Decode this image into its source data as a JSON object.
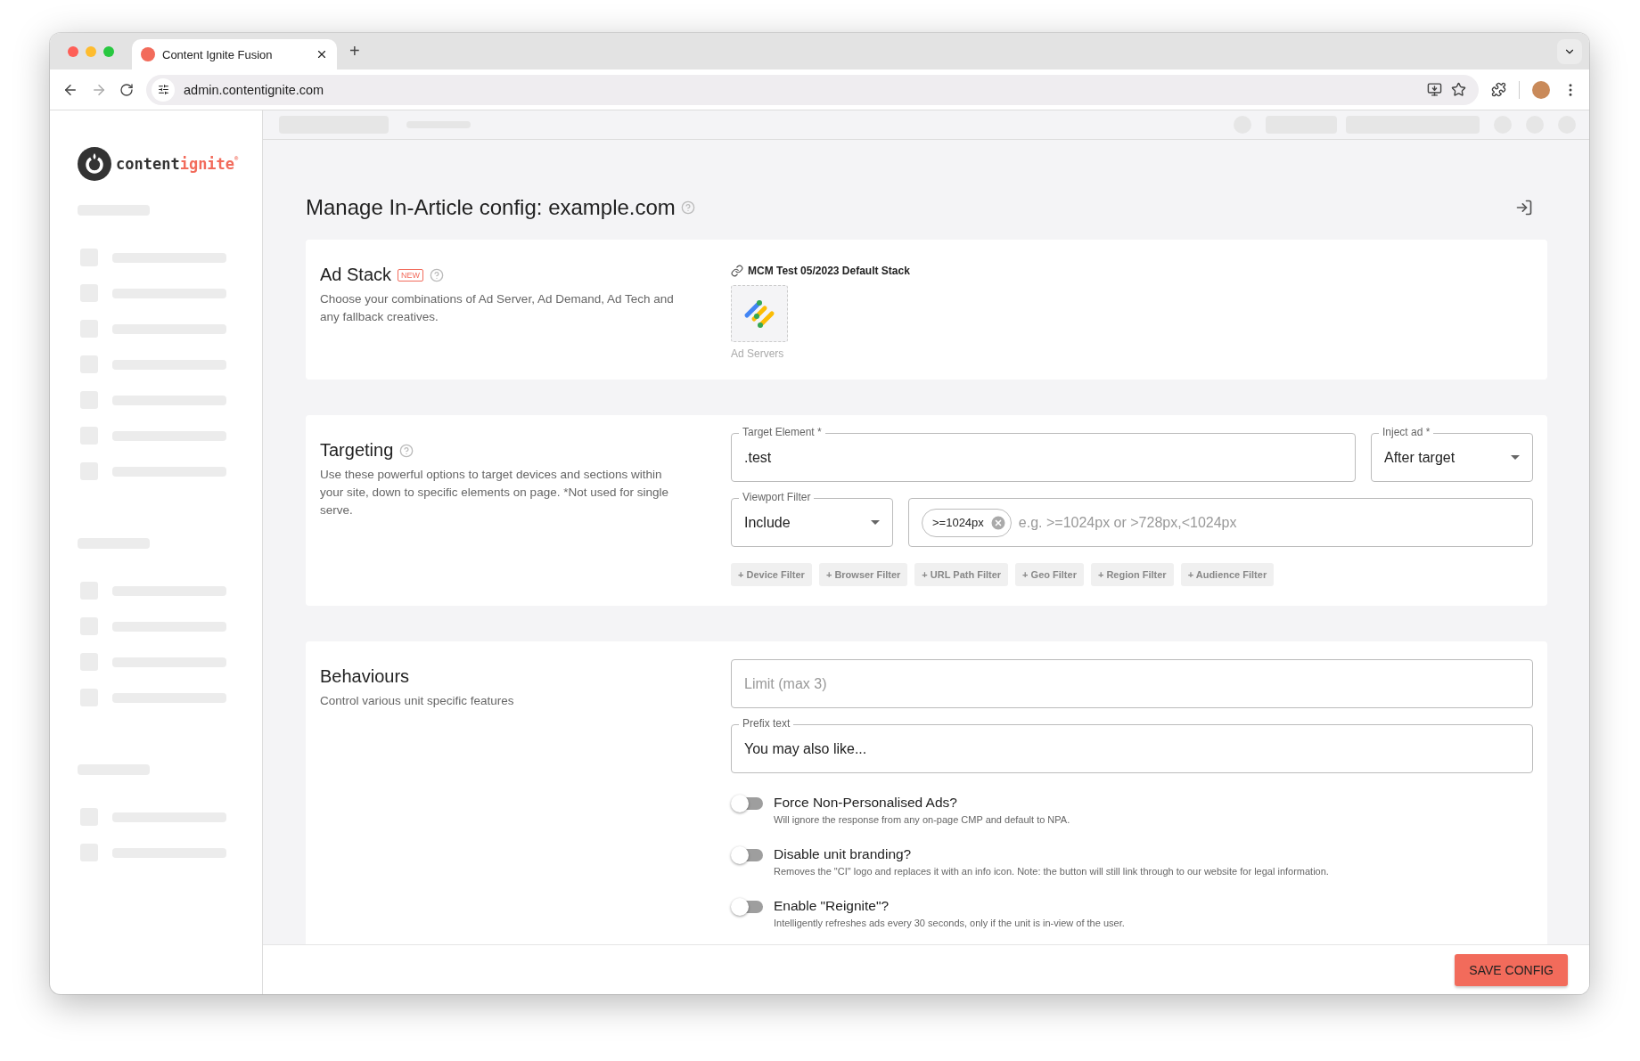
{
  "browser": {
    "tab_title": "Content Ignite Fusion",
    "new_tab": "+",
    "url": "admin.contentignite.com"
  },
  "sidebar": {
    "logo": [
      "content",
      "ignite",
      "®"
    ]
  },
  "page": {
    "title": "Manage In-Article config: example.com"
  },
  "sections": [
    {
      "kind": "ad_stack",
      "title": "Ad Stack",
      "badge": "NEW",
      "help": true,
      "description": "Choose your combinations of Ad Server, Ad Demand, Ad Tech and any fallback creatives.",
      "stack_name": "MCM Test 05/2023 Default Stack",
      "tiles": [
        {
          "label": "Ad Servers"
        }
      ]
    },
    {
      "kind": "targeting",
      "title": "Targeting",
      "help": true,
      "description": "Use these powerful options to target devices and sections within your site, down to specific elements on page. *Not used for single serve.",
      "target_element": {
        "label": "Target Element *",
        "value": ".test"
      },
      "inject_ad": {
        "label": "Inject ad *",
        "value": "After target"
      },
      "viewport_filter": {
        "label": "Viewport Filter",
        "value": "Include"
      },
      "viewport_values": {
        "chips": [
          ">=1024px"
        ],
        "placeholder": "e.g. >=1024px or >728px,<1024px"
      },
      "filters": [
        "+ Device Filter",
        "+ Browser Filter",
        "+ URL Path Filter",
        "+ Geo Filter",
        "+ Region Filter",
        "+ Audience Filter"
      ]
    },
    {
      "kind": "behaviours",
      "title": "Behaviours",
      "help": false,
      "description": "Control various unit specific features",
      "limit": {
        "placeholder": "Limit (max 3)"
      },
      "prefix": {
        "label": "Prefix text",
        "value": "You may also like..."
      },
      "toggles": [
        {
          "label": "Force Non-Personalised Ads?",
          "description": "Will ignore the response from any on-page CMP and default to NPA.",
          "on": false
        },
        {
          "label": "Disable unit branding?",
          "description": "Removes the \"CI\" logo and replaces it with an info icon. Note: the button will still link through to our website for legal information.",
          "on": false
        },
        {
          "label": "Enable \"Reignite\"?",
          "description": "Intelligently refreshes ads every 30 seconds, only if the unit is in-view of the user.",
          "on": false
        }
      ]
    }
  ],
  "footer": {
    "button": "SAVE CONFIG"
  }
}
